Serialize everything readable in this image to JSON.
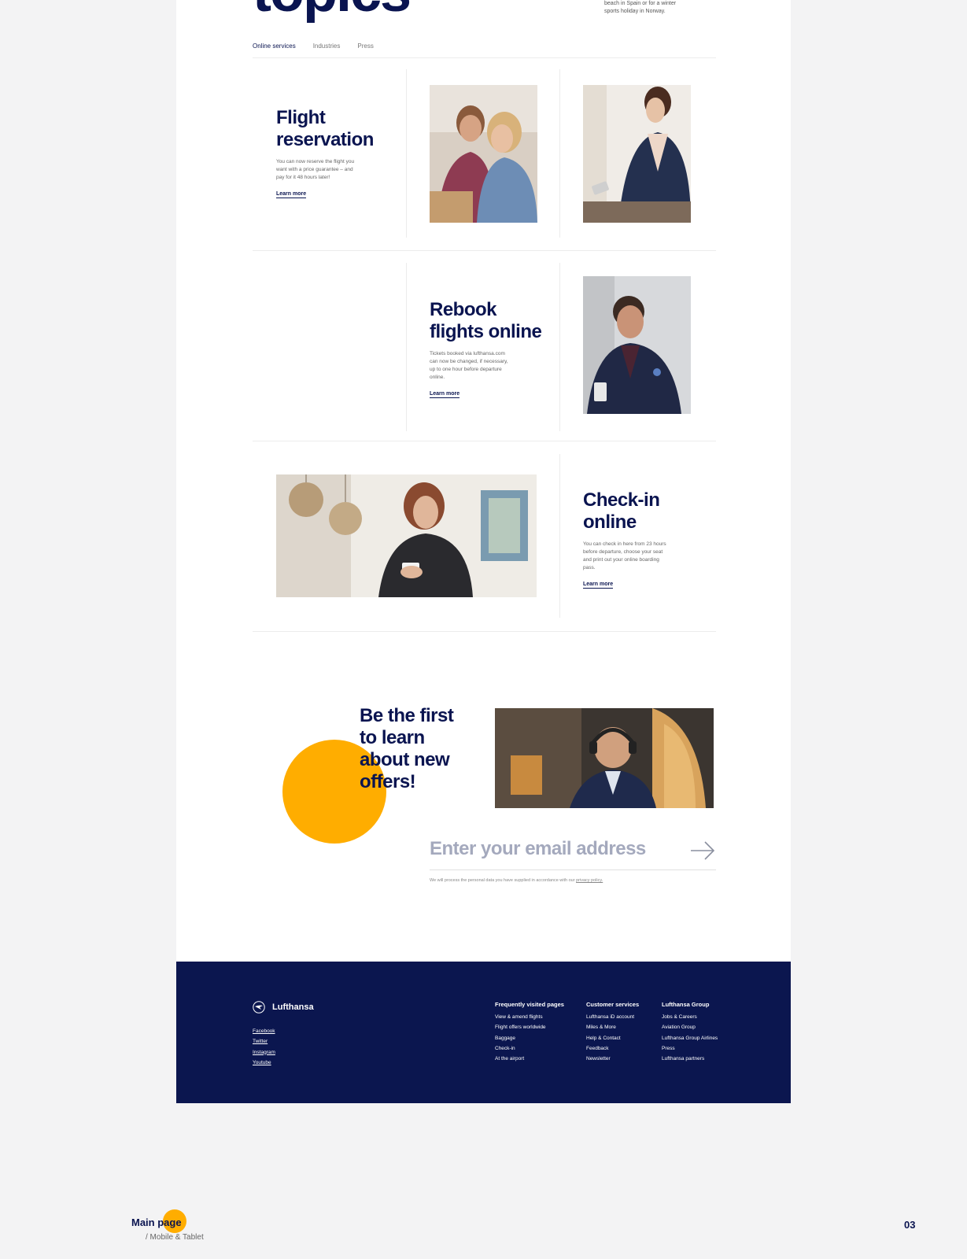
{
  "hero": {
    "title": "topics",
    "description": "beach in Spain or for a winter sports holiday in Norway."
  },
  "tabs": [
    "Online services",
    "Industries",
    "Press"
  ],
  "cards": [
    {
      "title": "Flight\nreservation",
      "description": "You can now reserve the flight you want with a price guarantee – and pay for it 48 hours later!",
      "link": "Learn more"
    },
    {
      "title": "Rebook\nflights online",
      "description": "Tickets booked via lufthansa.com can now be changed, if necessary, up to one hour before departure online.",
      "link": "Learn more"
    },
    {
      "title": "Check-in\nonline",
      "description": "You can check in here from 23 hours before departure, choose your seat and print out your online boarding pass.",
      "link": "Learn more"
    }
  ],
  "newsletter": {
    "title": "Be the first\nto learn\nabout new\noffers!",
    "email_placeholder": "Enter your email address",
    "privacy_text": "We will process the personal data you have supplied in accordance with our",
    "privacy_link": "privacy policy."
  },
  "footer": {
    "brand": "Lufthansa",
    "social": [
      "Facebook",
      "Twitter",
      "Instagram",
      "Youtube"
    ],
    "columns": [
      {
        "title": "Frequently visited pages",
        "links": [
          "View & amend flights",
          "Flight offers worldwide",
          "Baggage",
          "Check-in",
          "At the airport"
        ]
      },
      {
        "title": "Customer services",
        "links": [
          "Lufthansa iD account",
          "Miles & More",
          "Help & Contact",
          "Feedback",
          "Newsletter"
        ]
      },
      {
        "title": "Lufthansa Group",
        "links": [
          "Jobs & Careers",
          "Aviation Group",
          "Lufthansa Group Airlines",
          "Press",
          "Lufthansa partners"
        ]
      }
    ]
  },
  "slide": {
    "title": "Main page",
    "subtitle": "/ Mobile & Tablet",
    "page_number": "03"
  },
  "colors": {
    "navy": "#0a1450",
    "footer_bg": "#0b164f",
    "accent_yellow": "#ffad00",
    "page_bg": "#f3f3f4"
  }
}
